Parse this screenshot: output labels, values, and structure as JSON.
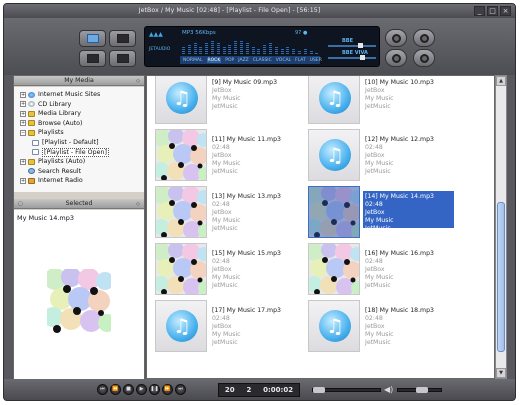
{
  "window": {
    "title": "JetBox / My Music  [02:48]    - [Playlist - File Open]  - [56:15]"
  },
  "window_controls": [
    "_",
    "□",
    "×"
  ],
  "display": {
    "logo_top": "▲▲▲",
    "logo_bottom": "JETAUDIO",
    "bitrate": "MP3 56Kbps",
    "vol_text": "97 ●",
    "eq_levels": [
      0.45,
      0.6,
      0.75,
      0.55,
      0.8,
      0.9,
      0.7,
      0.5,
      0.65,
      0.85,
      0.95,
      0.7,
      0.55,
      0.4,
      0.6,
      0.75,
      0.5,
      0.35,
      0.45,
      0.3,
      0.25,
      0.35,
      0.2,
      0.15
    ],
    "presets": [
      "NORMAL",
      "ROCK",
      "POP",
      "JAZZ",
      "CLASSIC",
      "VOCAL",
      "FLAT",
      "USER"
    ],
    "active_preset": "ROCK",
    "effects": [
      {
        "label": "BBE",
        "level": 0.7
      },
      {
        "label": "BBE VIVA",
        "level": 0.75
      }
    ]
  },
  "left_panel": {
    "my_media_header": "My Media",
    "selected_header": "Selected",
    "selected_item": "My Music 14.mp3",
    "tree": [
      {
        "label": "Internet Music Sites",
        "icon": "globe-icon",
        "expander": "+",
        "indent": 0
      },
      {
        "label": "CD Library",
        "icon": "cd-icon",
        "expander": "+",
        "indent": 0
      },
      {
        "label": "Media Library",
        "icon": "folder-icon",
        "expander": "+",
        "indent": 0
      },
      {
        "label": "Browse (Auto)",
        "icon": "folder-icon",
        "expander": "+",
        "indent": 0
      },
      {
        "label": "Playlists",
        "icon": "folder-icon",
        "expander": "−",
        "indent": 0
      },
      {
        "label": "[Playlist - Default]",
        "icon": "playlist-icon",
        "expander": "",
        "indent": 1
      },
      {
        "label": "[Playlist - File Open]",
        "icon": "playlist-icon",
        "expander": "",
        "indent": 1,
        "selected": true
      },
      {
        "label": "Playlists (Auto)",
        "icon": "folder-icon",
        "expander": "+",
        "indent": 0
      },
      {
        "label": "Search Result",
        "icon": "search-icon",
        "expander": "",
        "indent": 0
      },
      {
        "label": "Internet Radio",
        "icon": "radio-icon",
        "expander": "+",
        "indent": 0
      }
    ]
  },
  "tracks": [
    {
      "title": "[9] My Music 09.mp3",
      "duration": "",
      "artist": "JetBox",
      "album": "My Music",
      "genre": "JetMusic",
      "art": "note"
    },
    {
      "title": "[10] My Music 10.mp3",
      "duration": "",
      "artist": "JetBox",
      "album": "My Music",
      "genre": "JetMusic",
      "art": "note"
    },
    {
      "title": "[11] My Music 11.mp3",
      "duration": "02:48",
      "artist": "JetBox",
      "album": "My Music",
      "genre": "JetMusic",
      "art": "circles"
    },
    {
      "title": "[12] My Music 12.mp3",
      "duration": "02:48",
      "artist": "JetBox",
      "album": "My Music",
      "genre": "JetMusic",
      "art": "note"
    },
    {
      "title": "[13] My Music 13.mp3",
      "duration": "02:48",
      "artist": "JetBox",
      "album": "My Music",
      "genre": "JetMusic",
      "art": "circles"
    },
    {
      "title": "[14] My Music 14.mp3",
      "duration": "02:48",
      "artist": "JetBox",
      "album": "My Music",
      "genre": "JetMusic",
      "art": "circles",
      "selected": true
    },
    {
      "title": "[15] My Music 15.mp3",
      "duration": "02:48",
      "artist": "JetBox",
      "album": "My Music",
      "genre": "JetMusic",
      "art": "circles"
    },
    {
      "title": "[16] My Music 16.mp3",
      "duration": "02:48",
      "artist": "JetBox",
      "album": "My Music",
      "genre": "JetMusic",
      "art": "circles"
    },
    {
      "title": "[17] My Music 17.mp3",
      "duration": "02:48",
      "artist": "JetBox",
      "album": "My Music",
      "genre": "JetMusic",
      "art": "note"
    },
    {
      "title": "[18] My Music 18.mp3",
      "duration": "02:48",
      "artist": "JetBox",
      "album": "My Music",
      "genre": "JetMusic",
      "art": "note"
    }
  ],
  "transport": {
    "buttons": [
      {
        "name": "previous-icon",
        "glyph": "⏮"
      },
      {
        "name": "rewind-icon",
        "glyph": "⏪"
      },
      {
        "name": "stop-icon",
        "glyph": "■"
      },
      {
        "name": "play-icon",
        "glyph": "▶"
      },
      {
        "name": "pause-icon",
        "glyph": "❚❚"
      },
      {
        "name": "fast-forward-icon",
        "glyph": "⏩"
      },
      {
        "name": "next-icon",
        "glyph": "⏭"
      }
    ],
    "track_count": "20",
    "track_number": "2",
    "elapsed": "0:00:02",
    "volume_level": 0.55
  },
  "colors": {
    "accent": "#3465c4",
    "frame": "#58585e",
    "display_bg": "#0e1520"
  }
}
